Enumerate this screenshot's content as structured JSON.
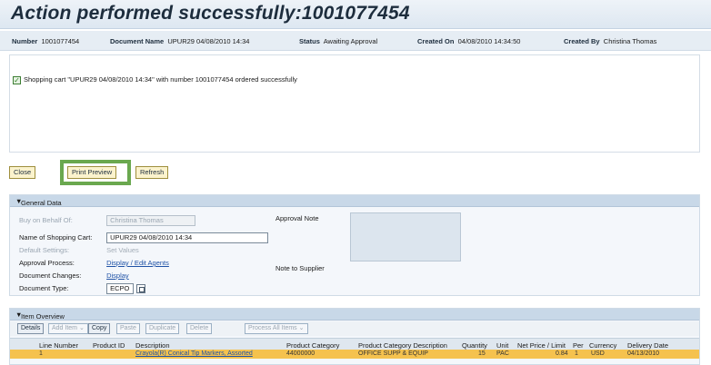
{
  "header": {
    "title": "Action performed successfully:1001077454"
  },
  "info": {
    "number_label": "Number",
    "number_value": "1001077454",
    "doc_name_label": "Document Name",
    "doc_name_value": "UPUR29 04/08/2010 14:34",
    "status_label": "Status",
    "status_value": "Awaiting Approval",
    "created_on_label": "Created On",
    "created_on_value": "04/08/2010 14:34:50",
    "created_by_label": "Created By",
    "created_by_value": "Christina Thomas"
  },
  "message": {
    "text": "Shopping cart \"UPUR29 04/08/2010 14:34\" with number 1001077454 ordered successfully"
  },
  "toolbar": {
    "close_label": "Close",
    "print_preview_label": "Print Preview",
    "refresh_label": "Refresh"
  },
  "general_data": {
    "title": "General Data",
    "buy_on_behalf_label": "Buy on Behalf Of:",
    "buy_on_behalf_value": "Christina Thomas",
    "cart_name_label": "Name of Shopping Cart:",
    "cart_name_value": "UPUR29 04/08/2010 14:34",
    "default_settings_label": "Default Settings:",
    "default_settings_value": "Set Values",
    "approval_process_label": "Approval Process:",
    "approval_process_value": "Display / Edit Agents",
    "document_changes_label": "Document Changes:",
    "document_changes_value": "Display",
    "document_type_label": "Document Type:",
    "document_type_value": "ECPO",
    "approval_note_label": "Approval Note",
    "note_to_supplier_label": "Note to Supplier"
  },
  "item_overview": {
    "title": "Item Overview",
    "buttons": {
      "details": "Details",
      "add_item": "Add Item ⌄",
      "copy": "Copy",
      "paste": "Paste",
      "duplicate": "Duplicate",
      "delete": "Delete",
      "process_all": "Process All Items ⌄"
    },
    "columns": {
      "line_number": "Line Number",
      "product_id": "Product ID",
      "description": "Description",
      "product_category": "Product Category",
      "category_description": "Product Category Description",
      "quantity": "Quantity",
      "unit": "Unit",
      "net_price": "Net Price / Limit",
      "per": "Per",
      "currency": "Currency",
      "delivery_date": "Delivery Date"
    },
    "rows": [
      {
        "line_number": "1",
        "description": "Crayola(R) Conical Tip Markers, Assorted",
        "product_category": "44000000",
        "category_description": "OFFICE SUPP & EQUIP",
        "quantity": "15",
        "unit": "PAC",
        "net_price": "0.84",
        "per": "1",
        "currency": "USD",
        "delivery_date": "04/13/2010"
      }
    ]
  }
}
